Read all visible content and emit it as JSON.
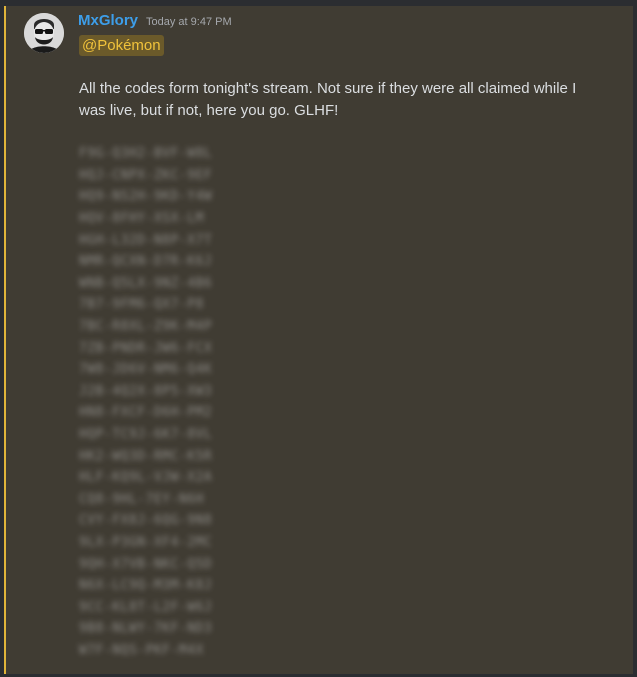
{
  "message": {
    "author": "MxGlory",
    "timestamp": "Today at 9:47 PM",
    "mention": "@Pokémon",
    "text": "All the codes form tonight's stream. Not sure if they were all claimed while I was live, but if not, here you go. GLHF!",
    "codes": [
      "F9G-Q3H2-BVF-W8L",
      "HQJ-CNPX-ZKC-9EF",
      "HQ9-NS2H-9KD-Y4W",
      "HQV-8FHY-XSX-LM",
      "HGH-L32D-N8P-X7T",
      "NMR-QCXN-D7R-K6J",
      "WNB-Q5LX-9NZ-4B6",
      "7B7-9FM6-QX7-P8",
      "7BC-R8XL-Z9K-M4P",
      "7ZB-PNDR-JW6-FCX",
      "7W8-JD6V-NM6-Q4K",
      "J2B-4Q2X-8P5-XW3",
      "HN8-FXCF-D6H-PM2",
      "HQP-TC9J-6K7-8VL",
      "HK2-WQ3D-RMC-K5R",
      "HLF-KQ9L-VJW-X2A",
      "CQ8-9HL-7EY-N6H",
      "CVY-FX8J-6QG-9N8",
      "9LX-P3GN-XF4-2MC",
      "9QH-X7VB-NKC-Q5D",
      "N6X-LC9Q-M3M-K8J",
      "9CC-KL8T-L2F-W6J",
      "9B8-NLWY-7KF-ND3",
      "W7F-NQS-PKF-M4X"
    ]
  }
}
